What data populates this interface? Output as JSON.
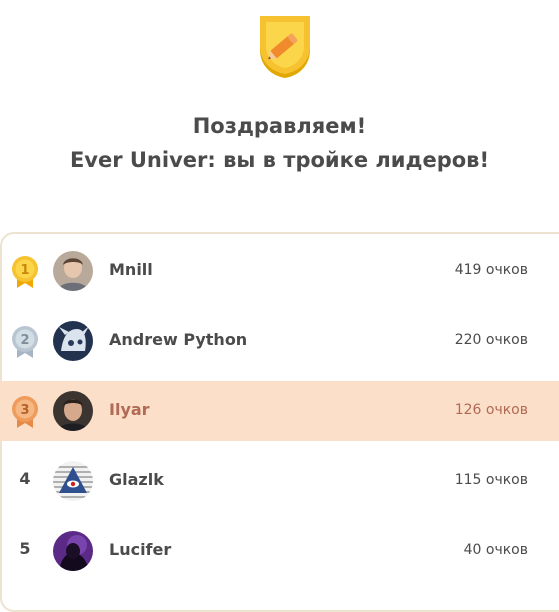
{
  "header": {
    "badge_icon": "pencil-shield-icon",
    "title": "Поздравляем!",
    "subtitle": "Ever Univer: вы в тройке лидеров!"
  },
  "colors": {
    "gold": "#f6c230",
    "silver": "#b9c6d1",
    "bronze": "#ef9b5b",
    "highlight_row": "#fcdfc8",
    "highlight_text": "#b06a55",
    "board_border": "#eee2d0"
  },
  "leaderboard": [
    {
      "rank": "1",
      "medal": "gold",
      "name": "Mnill",
      "score": "419 очков",
      "highlight": false
    },
    {
      "rank": "2",
      "medal": "silver",
      "name": "Andrew Python",
      "score": "220 очков",
      "highlight": false
    },
    {
      "rank": "3",
      "medal": "bronze",
      "name": "Ilyar",
      "score": "126 очков",
      "highlight": true
    },
    {
      "rank": "4",
      "medal": "",
      "name": "Glazlk",
      "score": "115 очков",
      "highlight": false
    },
    {
      "rank": "5",
      "medal": "",
      "name": "Lucifer",
      "score": "40 очков",
      "highlight": false
    }
  ]
}
